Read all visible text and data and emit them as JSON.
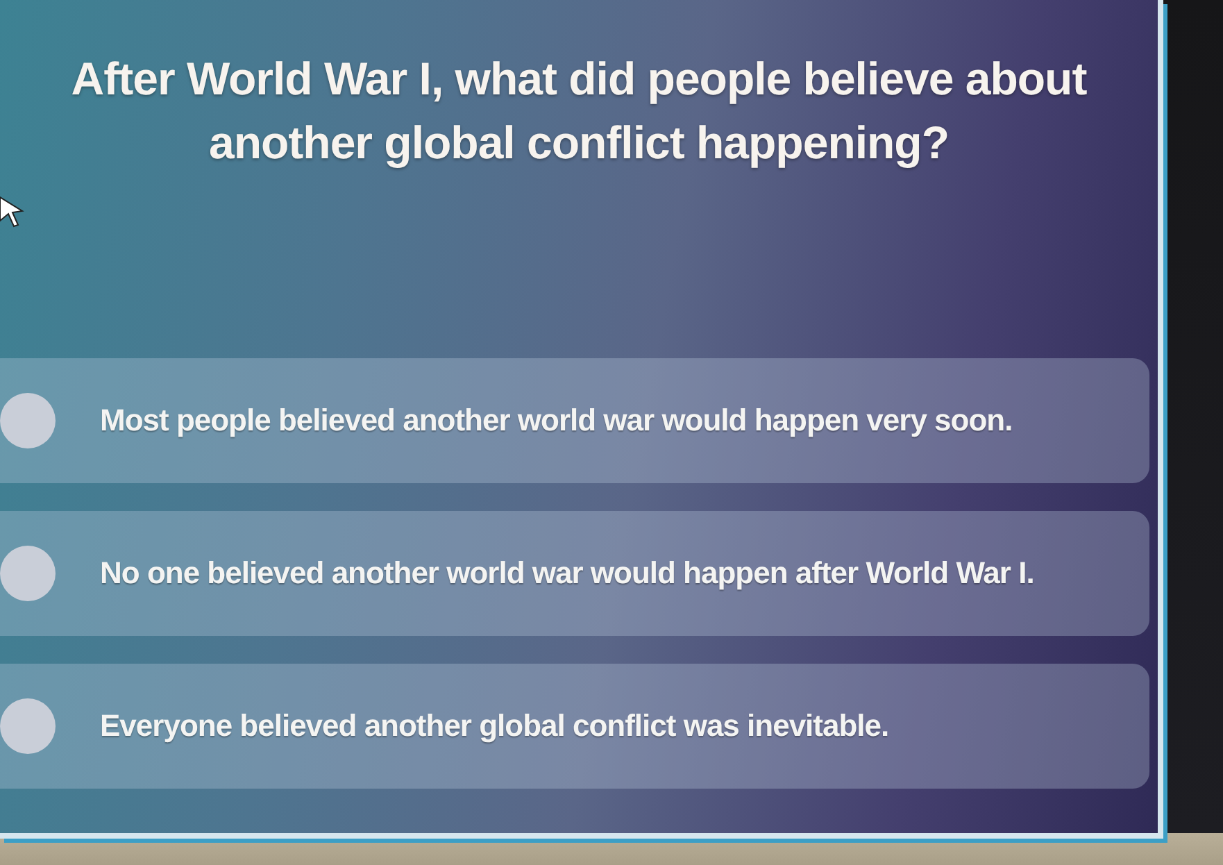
{
  "question": "After World War I, what did people believe about another global conflict happening?",
  "options": [
    {
      "text": "Most people believed another world war would happen very soon.",
      "selected": false
    },
    {
      "text": "No one believed another world war would happen after World War I.",
      "selected": false
    },
    {
      "text": "Everyone believed another global conflict was inevitable.",
      "selected": false
    }
  ]
}
